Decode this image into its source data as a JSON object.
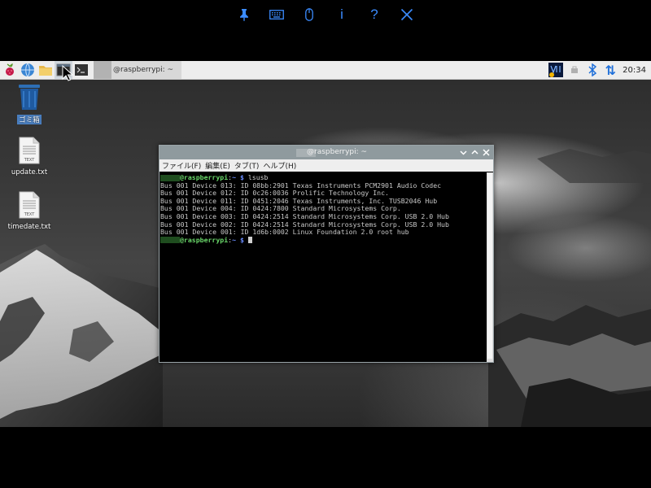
{
  "toolbar": {
    "buttons": [
      {
        "icon": "pin-icon"
      },
      {
        "icon": "keyboard-icon"
      },
      {
        "icon": "mouse-icon"
      },
      {
        "icon": "info-icon",
        "glyph": "i"
      },
      {
        "icon": "help-icon",
        "glyph": "?"
      },
      {
        "icon": "close-icon"
      }
    ]
  },
  "taskbar": {
    "task_title": "@raspberrypi: ~",
    "clock": "20:34",
    "tray_updown_glyph": "⇅"
  },
  "desktop": {
    "icons": [
      {
        "label": "ゴミ箱"
      },
      {
        "label": "update.txt",
        "badge": "TEXT"
      },
      {
        "label": "timedate.txt",
        "badge": "TEXT"
      }
    ]
  },
  "terminal": {
    "title": "@raspberrypi: ~",
    "menu": [
      "ファイル(F)",
      "編集(E)",
      "タブ(T)",
      "ヘルプ(H)"
    ],
    "prompt_host": "@raspberrypi",
    "prompt_sep": ":",
    "prompt_dir": "~",
    "prompt_symbol": "$",
    "command": "lsusb",
    "output": [
      "Bus 001 Device 013: ID 08bb:2901 Texas Instruments PCM2901 Audio Codec",
      "Bus 001 Device 012: ID 0c26:0036 Prolific Technology Inc.",
      "Bus 001 Device 011: ID 0451:2046 Texas Instruments, Inc. TUSB2046 Hub",
      "Bus 001 Device 004: ID 0424:7800 Standard Microsystems Corp.",
      "Bus 001 Device 003: ID 0424:2514 Standard Microsystems Corp. USB 2.0 Hub",
      "Bus 001 Device 002: ID 0424:2514 Standard Microsystems Corp. USB 2.0 Hub",
      "Bus 001 Device 001: ID 1d6b:0002 Linux Foundation 2.0 root hub"
    ]
  },
  "colors": {
    "toolbar_icon": "#3b8cff",
    "prompt_user": "#6ad86a",
    "prompt_dir": "#6a8cff"
  }
}
